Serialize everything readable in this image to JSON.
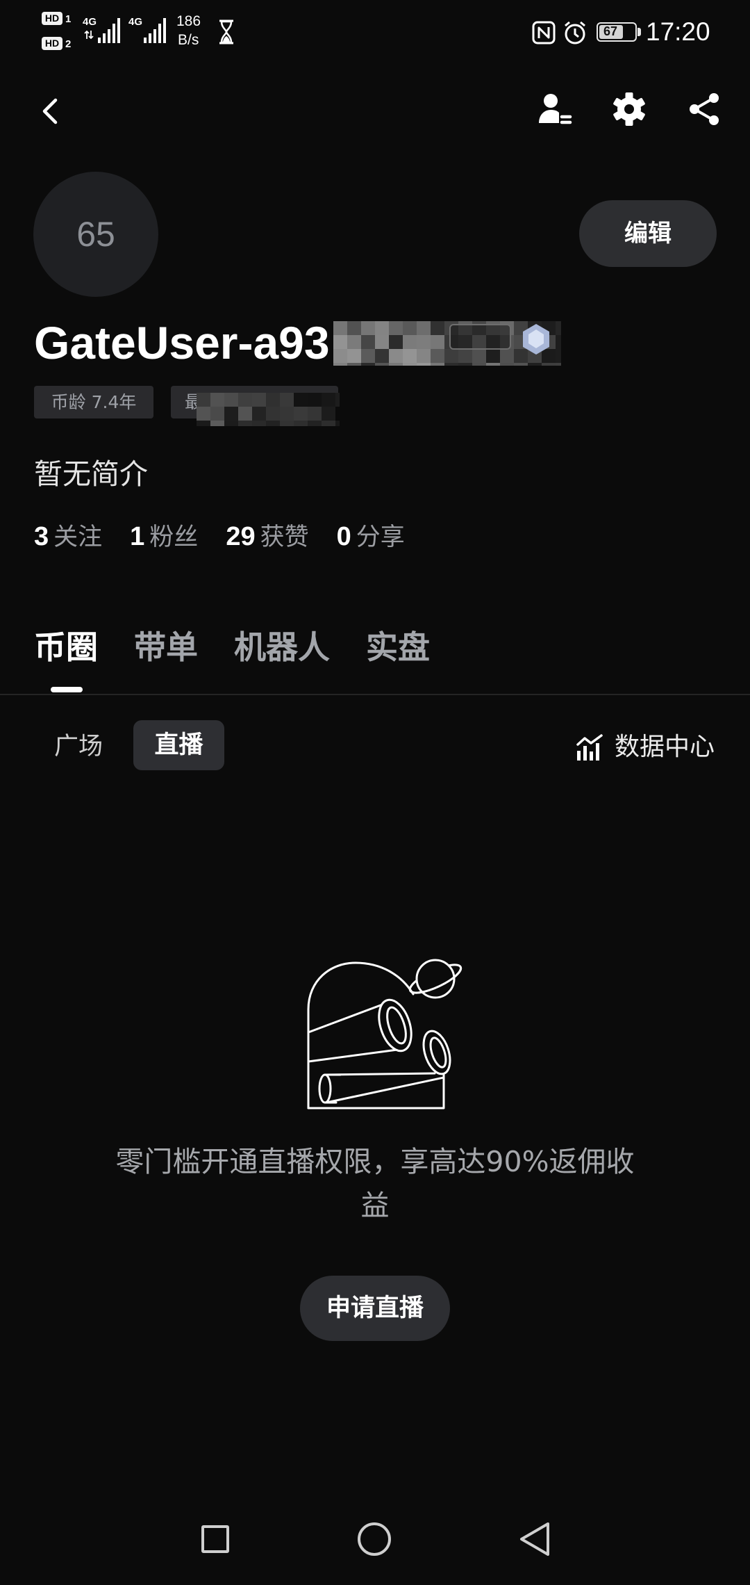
{
  "status_bar": {
    "sim1_label": "HD",
    "sim1_number": "1",
    "sim2_label": "HD",
    "sim2_number": "2",
    "network1": "4G",
    "network2": "4G",
    "speed_value": "186",
    "speed_unit": "B/s",
    "battery_level": "67",
    "battery_fraction": 0.67,
    "time": "17:20",
    "icons": {
      "transfer": "data-transfer-icon",
      "signal": "signal-bars-icon",
      "hourglass": "hourglass-icon",
      "nfc": "nfc-icon",
      "alarm": "alarm-clock-icon",
      "battery": "battery-icon"
    }
  },
  "header": {
    "icons": {
      "back": "back-arrow-icon",
      "account": "person-switch-icon",
      "settings": "gear-icon",
      "share": "share-icon"
    }
  },
  "profile": {
    "avatar_text": "65",
    "edit_label": "编辑",
    "username": "GateUser-a93",
    "level_icon": "level-badge-icon",
    "tags": [
      {
        "label": "币龄 7.4年"
      },
      {
        "label": "最"
      }
    ],
    "bio": "暂无简介",
    "stats": [
      {
        "value": "3",
        "label": "关注"
      },
      {
        "value": "1",
        "label": "粉丝"
      },
      {
        "value": "29",
        "label": "获赞"
      },
      {
        "value": "0",
        "label": "分享"
      }
    ]
  },
  "tabs": [
    {
      "label": "币圈",
      "active": true
    },
    {
      "label": "带单",
      "active": false
    },
    {
      "label": "机器人",
      "active": false
    },
    {
      "label": "实盘",
      "active": false
    }
  ],
  "sub_tabs": {
    "items": [
      {
        "label": "广场",
        "active": false
      },
      {
        "label": "直播",
        "active": true
      }
    ],
    "data_center_label": "数据中心",
    "data_center_icon": "chart-icon"
  },
  "empty_state": {
    "illustration": "observatory-telescope-illustration",
    "message": "零门槛开通直播权限，享高达90%返佣收益",
    "apply_button": "申请直播"
  },
  "nav_bar": {
    "icons": {
      "recents": "square-icon",
      "home": "circle-icon",
      "back": "triangle-back-icon"
    }
  },
  "colors": {
    "background": "#0b0b0b",
    "surface": "#2d2e32",
    "text_primary": "#ffffff",
    "text_secondary": "#a6a8ac"
  }
}
